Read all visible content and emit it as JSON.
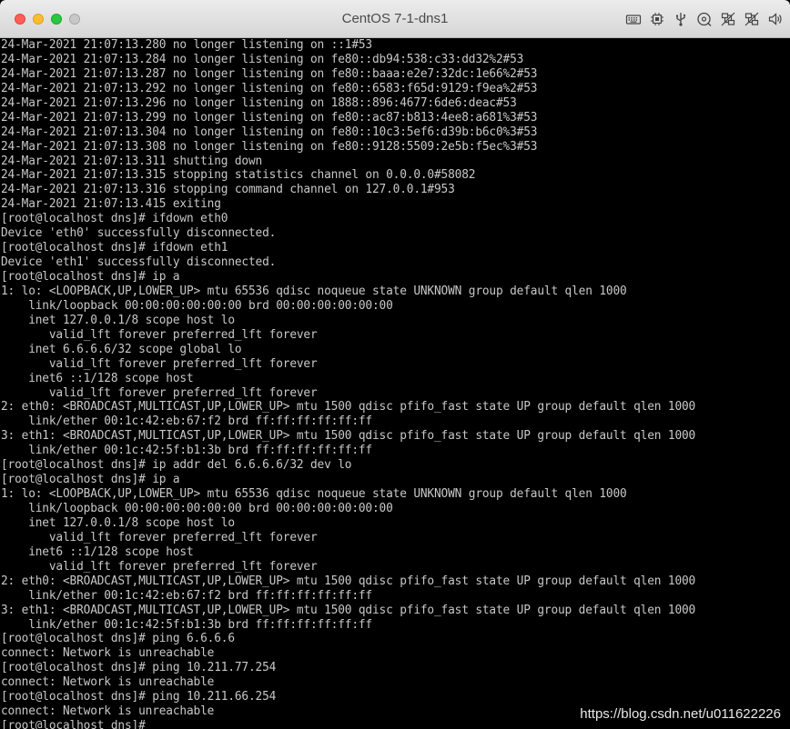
{
  "window": {
    "title": "CentOS 7-1-dns1",
    "toolbar_icons": [
      "keyboard-icon",
      "cpu-chip-icon",
      "usb-icon",
      "disc-icon",
      "network-disabled-icon",
      "network-disabled-icon",
      "speaker-icon"
    ]
  },
  "terminal": {
    "lines": [
      "24-Mar-2021 21:07:13.280 no longer listening on ::1#53",
      "24-Mar-2021 21:07:13.284 no longer listening on fe80::db94:538:c33:dd32%2#53",
      "24-Mar-2021 21:07:13.287 no longer listening on fe80::baaa:e2e7:32dc:1e66%2#53",
      "24-Mar-2021 21:07:13.292 no longer listening on fe80::6583:f65d:9129:f9ea%2#53",
      "24-Mar-2021 21:07:13.296 no longer listening on 1888::896:4677:6de6:deac#53",
      "24-Mar-2021 21:07:13.299 no longer listening on fe80::ac87:b813:4ee8:a681%3#53",
      "24-Mar-2021 21:07:13.304 no longer listening on fe80::10c3:5ef6:d39b:b6c0%3#53",
      "24-Mar-2021 21:07:13.308 no longer listening on fe80::9128:5509:2e5b:f5ec%3#53",
      "24-Mar-2021 21:07:13.311 shutting down",
      "24-Mar-2021 21:07:13.315 stopping statistics channel on 0.0.0.0#58082",
      "24-Mar-2021 21:07:13.316 stopping command channel on 127.0.0.1#953",
      "24-Mar-2021 21:07:13.415 exiting",
      "[root@localhost dns]# ifdown eth0",
      "Device 'eth0' successfully disconnected.",
      "[root@localhost dns]# ifdown eth1",
      "Device 'eth1' successfully disconnected.",
      "[root@localhost dns]# ip a",
      "1: lo: <LOOPBACK,UP,LOWER_UP> mtu 65536 qdisc noqueue state UNKNOWN group default qlen 1000",
      "    link/loopback 00:00:00:00:00:00 brd 00:00:00:00:00:00",
      "    inet 127.0.0.1/8 scope host lo",
      "       valid_lft forever preferred_lft forever",
      "    inet 6.6.6.6/32 scope global lo",
      "       valid_lft forever preferred_lft forever",
      "    inet6 ::1/128 scope host",
      "       valid_lft forever preferred_lft forever",
      "2: eth0: <BROADCAST,MULTICAST,UP,LOWER_UP> mtu 1500 qdisc pfifo_fast state UP group default qlen 1000",
      "    link/ether 00:1c:42:eb:67:f2 brd ff:ff:ff:ff:ff:ff",
      "3: eth1: <BROADCAST,MULTICAST,UP,LOWER_UP> mtu 1500 qdisc pfifo_fast state UP group default qlen 1000",
      "    link/ether 00:1c:42:5f:b1:3b brd ff:ff:ff:ff:ff:ff",
      "[root@localhost dns]# ip addr del 6.6.6.6/32 dev lo",
      "[root@localhost dns]# ip a",
      "1: lo: <LOOPBACK,UP,LOWER_UP> mtu 65536 qdisc noqueue state UNKNOWN group default qlen 1000",
      "    link/loopback 00:00:00:00:00:00 brd 00:00:00:00:00:00",
      "    inet 127.0.0.1/8 scope host lo",
      "       valid_lft forever preferred_lft forever",
      "    inet6 ::1/128 scope host",
      "       valid_lft forever preferred_lft forever",
      "2: eth0: <BROADCAST,MULTICAST,UP,LOWER_UP> mtu 1500 qdisc pfifo_fast state UP group default qlen 1000",
      "    link/ether 00:1c:42:eb:67:f2 brd ff:ff:ff:ff:ff:ff",
      "3: eth1: <BROADCAST,MULTICAST,UP,LOWER_UP> mtu 1500 qdisc pfifo_fast state UP group default qlen 1000",
      "    link/ether 00:1c:42:5f:b1:3b brd ff:ff:ff:ff:ff:ff",
      "[root@localhost dns]# ping 6.6.6.6",
      "connect: Network is unreachable",
      "[root@localhost dns]# ping 10.211.77.254",
      "connect: Network is unreachable",
      "[root@localhost dns]# ping 10.211.66.254",
      "connect: Network is unreachable",
      "[root@localhost dns]# "
    ]
  },
  "watermark": "https://blog.csdn.net/u011622226",
  "colors": {
    "terminal_bg": "#000000",
    "terminal_fg": "#c8c8c8",
    "close": "#ff5f57",
    "minimize": "#febc2e",
    "maximize": "#28c840"
  }
}
